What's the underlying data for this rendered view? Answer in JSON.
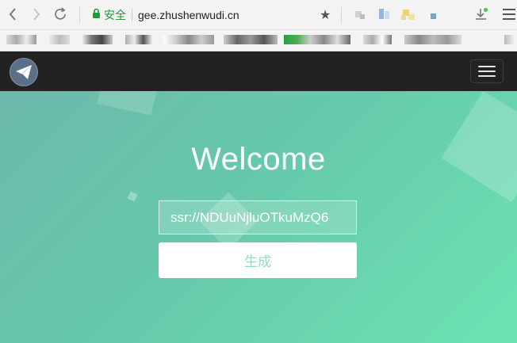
{
  "browser": {
    "secure_label": "安全",
    "url": "gee.zhushenwudi.cn",
    "star_icon": "star-icon",
    "back_icon": "chevron-left-icon",
    "forward_icon": "chevron-right-icon",
    "reload_icon": "reload-icon",
    "lock_icon": "lock-icon",
    "download_icon": "download-icon",
    "menu_icon": "menu-icon"
  },
  "navbar": {
    "logo_icon": "paper-plane-logo",
    "toggle_icon": "hamburger-icon",
    "background": "#222222"
  },
  "hero": {
    "title": "Welcome",
    "input_value": "ssr://NDUuNjluOTkuMzQ6",
    "button_label": "生成",
    "accent": "#66c9ab",
    "button_text_color": "#8fe0c3"
  }
}
